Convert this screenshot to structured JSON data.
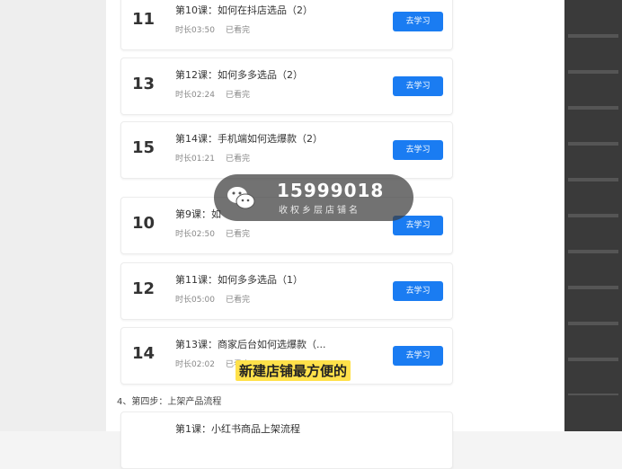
{
  "lessons": [
    {
      "number": "11",
      "title": "第10课：如何在抖店选品（2）",
      "duration": "时长03:50",
      "status": "已看完",
      "button": "去学习"
    },
    {
      "number": "13",
      "title": "第12课：如何多多选品（2）",
      "duration": "时长02:24",
      "status": "已看完",
      "button": "去学习"
    },
    {
      "number": "15",
      "title": "第14课：手机端如何选爆款（2）",
      "duration": "时长01:21",
      "status": "已看完",
      "button": "去学习"
    },
    {
      "number": "10",
      "title": "第9课：如",
      "duration": "时长02:50",
      "status": "已看完",
      "button": "去学习"
    },
    {
      "number": "12",
      "title": "第11课：如何多多选品（1）",
      "duration": "时长05:00",
      "status": "已看完",
      "button": "去学习"
    },
    {
      "number": "14",
      "title": "第13课：商家后台如何选爆款（...",
      "duration": "时长02:02",
      "status": "已看完",
      "button": "去学习"
    }
  ],
  "step": {
    "label": "4、第四步：上架产品流程"
  },
  "next_card": {
    "title": "第1课：小红书商品上架流程"
  },
  "watermark": {
    "icon": "wechat-icon",
    "number": "15999018",
    "subtitle": "收权乡层店铺名"
  },
  "caption": {
    "text": "新建店铺最方便的"
  },
  "colors": {
    "button": "#1a7cf2",
    "caption_bg": "#ffe14a"
  }
}
